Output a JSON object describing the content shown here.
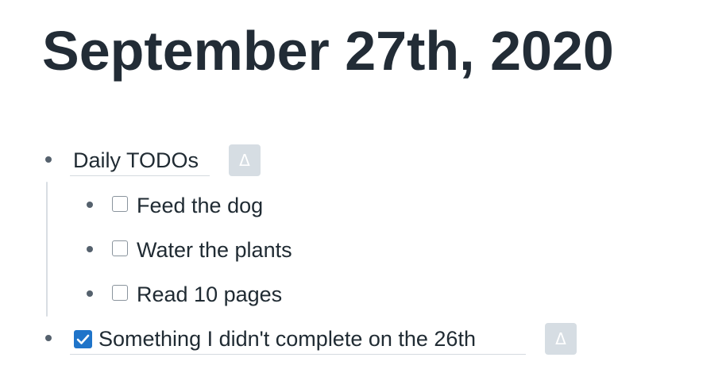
{
  "page": {
    "title": "September 27th, 2020"
  },
  "blocks": [
    {
      "text": "Daily TODOs",
      "button_label": "Δ",
      "children": [
        {
          "text": "Feed the dog",
          "checked": false
        },
        {
          "text": "Water the plants",
          "checked": false
        },
        {
          "text": "Read 10 pages",
          "checked": false
        }
      ]
    },
    {
      "text": "Something I didn't complete on the 26th",
      "checked": true,
      "button_label": "Δ"
    }
  ],
  "colors": {
    "text": "#202b33",
    "bullet": "#55616d",
    "delta_button_bg": "#d6dde3",
    "checkbox_checked": "#1f74c9"
  }
}
